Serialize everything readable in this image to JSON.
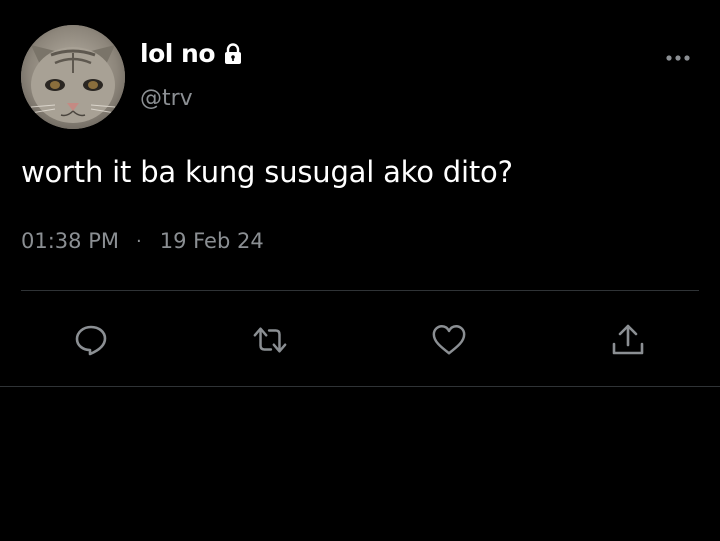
{
  "tweet": {
    "display_name": "lol no",
    "handle": "@trv",
    "text": "worth it ba kung susugal ako dito?",
    "time": "01:38 PM",
    "separator": "·",
    "date": "19 Feb 24",
    "locked": true
  },
  "icons": {
    "lock": "lock-icon",
    "more": "more-horizontal-icon",
    "reply": "reply-icon",
    "retweet": "retweet-icon",
    "like": "heart-icon",
    "share": "share-icon"
  },
  "colors": {
    "background": "#000000",
    "primary_text": "#ffffff",
    "secondary_text": "#8b8f93",
    "divider": "#2f3336"
  }
}
